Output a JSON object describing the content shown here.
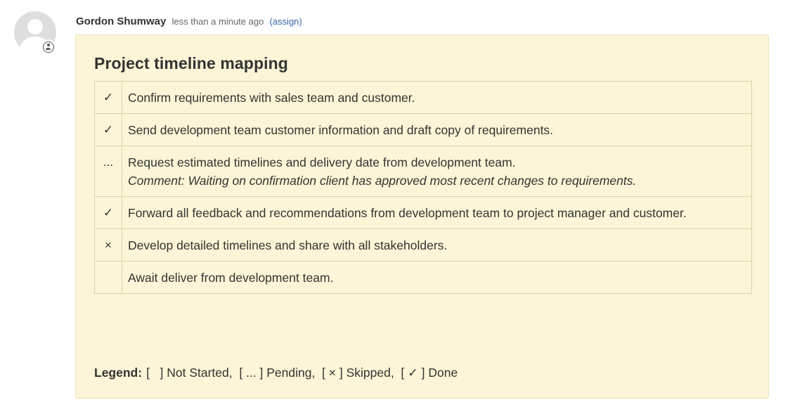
{
  "comment": {
    "author": "Gordon Shumway",
    "time": "less than a minute ago",
    "assign_label": "(assign)",
    "avatar_icon": "user-placeholder-icon",
    "badge_icon": "user-circle-icon"
  },
  "card": {
    "title": "Project timeline mapping",
    "background": "#fcf5d7",
    "tasks": [
      {
        "status": "✓",
        "text": "Confirm requirements with sales team and customer.",
        "comment": ""
      },
      {
        "status": "✓",
        "text": "Send development team customer information and draft copy of requirements.",
        "comment": ""
      },
      {
        "status": "...",
        "text": "Request estimated timelines and delivery date from development team.",
        "comment": "Comment: Waiting on confirmation client has approved most recent changes to requirements."
      },
      {
        "status": "✓",
        "text": "Forward all feedback and recommendations from development team to project manager and customer.",
        "comment": ""
      },
      {
        "status": "×",
        "text": "Develop detailed timelines and share with all stakeholders.",
        "comment": ""
      },
      {
        "status": "",
        "text": "Await deliver from development team.",
        "comment": ""
      }
    ],
    "legend": {
      "label": "Legend:",
      "text": "[   ] Not Started,  [ ... ] Pending,  [ × ] Skipped,  [ ✓ ] Done"
    }
  }
}
